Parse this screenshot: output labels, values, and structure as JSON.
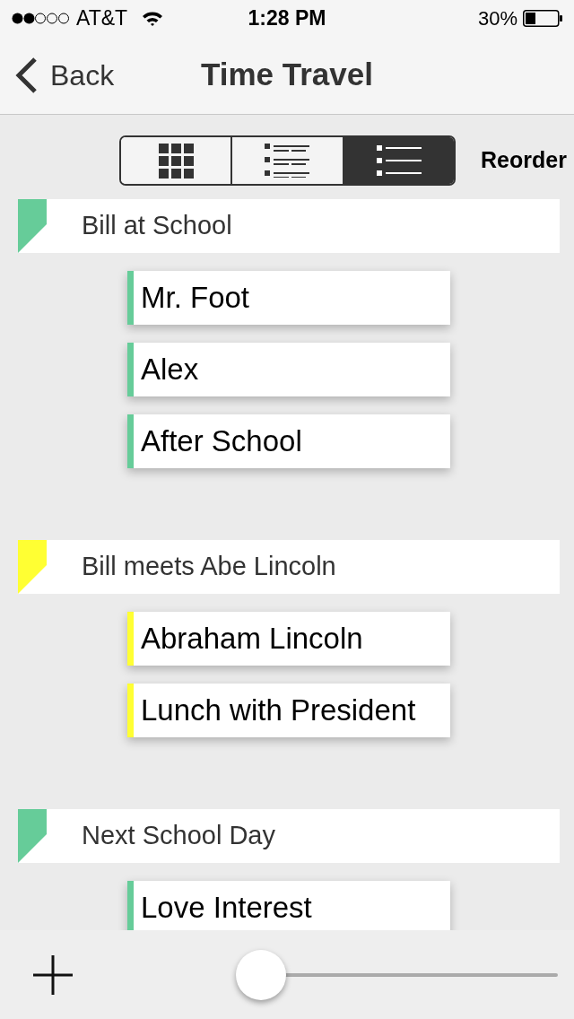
{
  "status_bar": {
    "carrier": "AT&T",
    "time": "1:28 PM",
    "battery": "30%"
  },
  "nav": {
    "back": "Back",
    "title": "Time Travel"
  },
  "view_switcher": {
    "segments": [
      {
        "kind": "grid",
        "selected": false
      },
      {
        "kind": "detail",
        "selected": false
      },
      {
        "kind": "list",
        "selected": true
      }
    ],
    "reorder": "Reorder"
  },
  "sections": [
    {
      "title": "Bill at School",
      "color": "#66cc99",
      "cards": [
        "Mr. Foot",
        "Alex",
        "After School"
      ]
    },
    {
      "title": "Bill meets Abe Lincoln",
      "color": "#ffff33",
      "cards": [
        "Abraham Lincoln",
        "Lunch with President"
      ]
    },
    {
      "title": "Next School Day",
      "color": "#66cc99",
      "cards": [
        "Love Interest"
      ]
    }
  ],
  "toolbar": {
    "zoom_slider": {
      "level": 0
    }
  }
}
